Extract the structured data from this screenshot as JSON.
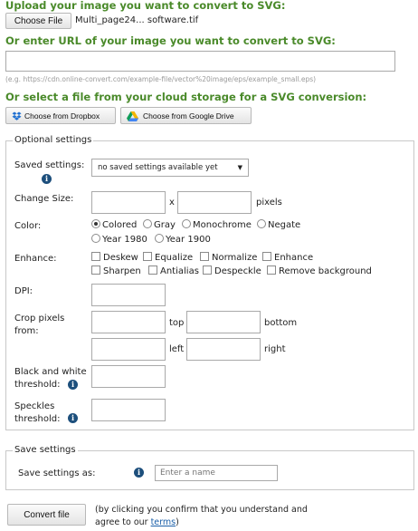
{
  "upload": {
    "heading": "Upload your image you want to convert to SVG:",
    "choose_file_label": "Choose File",
    "file_name": "Multi_page24... software.tif"
  },
  "url": {
    "heading": "Or enter URL of your image you want to convert to SVG:",
    "value": "",
    "example": "(e.g. https://cdn.online-convert.com/example-file/vector%20image/eps/example_small.eps)"
  },
  "cloud": {
    "heading": "Or select a file from your cloud storage for a SVG conversion:",
    "dropbox_label": "Choose from Dropbox",
    "gdrive_label": "Choose from Google Drive"
  },
  "optional": {
    "legend": "Optional settings",
    "saved_settings_label": "Saved settings:",
    "saved_settings_value": "no saved settings available yet",
    "change_size_label": "Change Size:",
    "size_x": "x",
    "size_unit": "pixels",
    "color_label": "Color:",
    "color_options": [
      "Colored",
      "Gray",
      "Monochrome",
      "Negate",
      "Year 1980",
      "Year 1900"
    ],
    "color_selected": "Colored",
    "enhance_label": "Enhance:",
    "enhance_options": [
      "Deskew",
      "Equalize",
      "Normalize",
      "Enhance",
      "Sharpen",
      "Antialias",
      "Despeckle",
      "Remove background"
    ],
    "dpi_label": "DPI:",
    "crop_label_1": "Crop pixels",
    "crop_label_2": "from:",
    "crop_top": "top",
    "crop_bottom": "bottom",
    "crop_left": "left",
    "crop_right": "right",
    "bw_label_1": "Black and white",
    "bw_label_2": "threshold:",
    "speckles_label_1": "Speckles",
    "speckles_label_2": "threshold:"
  },
  "save": {
    "legend": "Save settings",
    "label": "Save settings as:",
    "placeholder": "Enter a name"
  },
  "convert": {
    "button_label": "Convert file",
    "note_1": "(by clicking you confirm that you understand and",
    "note_2": "agree to our ",
    "terms_link": "terms",
    "note_end": ")"
  }
}
